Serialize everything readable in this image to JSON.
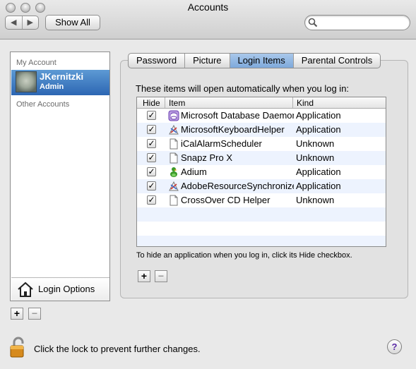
{
  "window": {
    "title": "Accounts"
  },
  "toolbar": {
    "back": "◀",
    "forward": "▶",
    "show_all": "Show All",
    "search_placeholder": ""
  },
  "sidebar": {
    "my_account_header": "My Account",
    "selected_account": {
      "name": "JKernitzki",
      "role": "Admin"
    },
    "other_accounts_header": "Other Accounts",
    "login_options": "Login Options",
    "add": "+",
    "remove": "−"
  },
  "tabs": [
    {
      "label": "Password",
      "active": false
    },
    {
      "label": "Picture",
      "active": false
    },
    {
      "label": "Login Items",
      "active": true
    },
    {
      "label": "Parental Controls",
      "active": false
    }
  ],
  "login_items": {
    "intro": "These items will open automatically when you log in:",
    "columns": {
      "hide": "Hide",
      "item": "Item",
      "kind": "Kind"
    },
    "rows": [
      {
        "hide": true,
        "name": "Microsoft Database Daemon",
        "kind": "Application",
        "icon": "database-daemon-icon"
      },
      {
        "hide": true,
        "name": "MicrosoftKeyboardHelper",
        "kind": "Application",
        "icon": "application-icon"
      },
      {
        "hide": true,
        "name": "iCalAlarmScheduler",
        "kind": "Unknown",
        "icon": "document-icon"
      },
      {
        "hide": true,
        "name": "Snapz Pro X",
        "kind": "Unknown",
        "icon": "document-icon"
      },
      {
        "hide": true,
        "name": "Adium",
        "kind": "Application",
        "icon": "adium-duck-icon"
      },
      {
        "hide": true,
        "name": "AdobeResourceSynchronizer",
        "kind": "Application",
        "icon": "application-icon"
      },
      {
        "hide": true,
        "name": "CrossOver CD Helper",
        "kind": "Unknown",
        "icon": "document-icon"
      }
    ],
    "hint": "To hide an application when you log in, click its Hide checkbox.",
    "add": "+",
    "remove": "−"
  },
  "footer": {
    "lock_message": "Click the lock to prevent further changes.",
    "help": "?"
  }
}
